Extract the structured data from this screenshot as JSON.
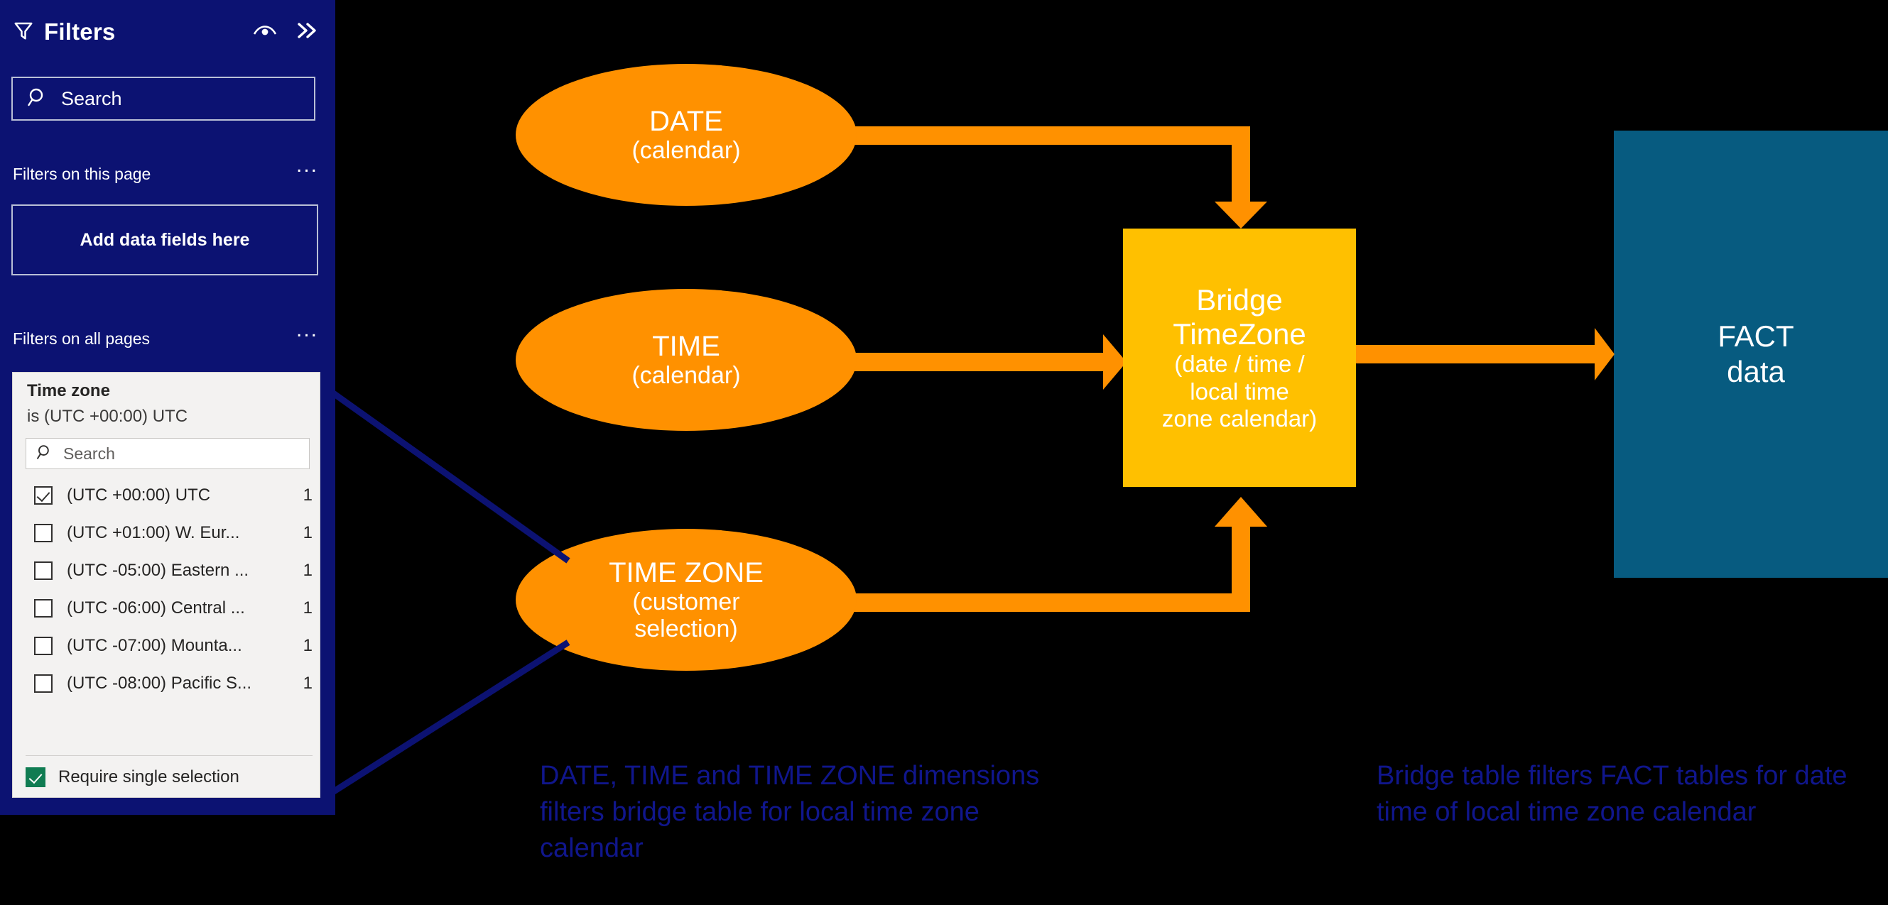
{
  "filters_pane": {
    "title": "Filters",
    "icons": {
      "funnel": "funnel-icon",
      "eye": "eye-icon",
      "expand": "double-chevron-right-icon"
    },
    "search": {
      "placeholder": "Search",
      "value": "",
      "icon": "search-icon"
    },
    "sections": [
      {
        "label": "Filters on this page",
        "more": "...",
        "dropzone_label": "Add data fields here"
      },
      {
        "label": "Filters on all pages",
        "more": "..."
      }
    ],
    "time_zone_filter": {
      "title": "Time zone",
      "condition": "is (UTC +00:00) UTC",
      "search": {
        "placeholder": "Search",
        "value": "",
        "icon": "search-icon"
      },
      "items": [
        {
          "label": "(UTC +00:00) UTC",
          "count": "1",
          "checked": true
        },
        {
          "label": "(UTC +01:00) W. Eur...",
          "count": "1",
          "checked": false
        },
        {
          "label": "(UTC -05:00) Eastern ...",
          "count": "1",
          "checked": false
        },
        {
          "label": "(UTC -06:00) Central ...",
          "count": "1",
          "checked": false
        },
        {
          "label": "(UTC -07:00) Mounta...",
          "count": "1",
          "checked": false
        },
        {
          "label": "(UTC -08:00) Pacific S...",
          "count": "1",
          "checked": false
        }
      ],
      "footer": {
        "label": "Require single selection",
        "checked": true
      }
    }
  },
  "diagram": {
    "nodes": {
      "date": {
        "main": "DATE",
        "sub": "(calendar)"
      },
      "time": {
        "main": "TIME",
        "sub": "(calendar)"
      },
      "time_zone": {
        "main": "TIME ZONE",
        "sub1": "(customer",
        "sub2": "selection)"
      },
      "bridge": {
        "main1": "Bridge",
        "main2": "TimeZone",
        "sub1": "(date / time /",
        "sub2": "local time",
        "sub3": "zone calendar)"
      },
      "fact": {
        "main1": "FACT",
        "main2": "data"
      }
    },
    "captions": {
      "left": "DATE, TIME and TIME ZONE dimensions filters bridge table for local time zone calendar",
      "right": "Bridge table filters FACT tables for date time of local time zone calendar"
    },
    "colors": {
      "ellipse": "#FF9100",
      "bridge": "#FFC000",
      "fact": "#075B80",
      "arrow": "#FF9100",
      "caption": "#10168C",
      "pane": "#0C1272",
      "callout_line": "#0C1272"
    }
  }
}
